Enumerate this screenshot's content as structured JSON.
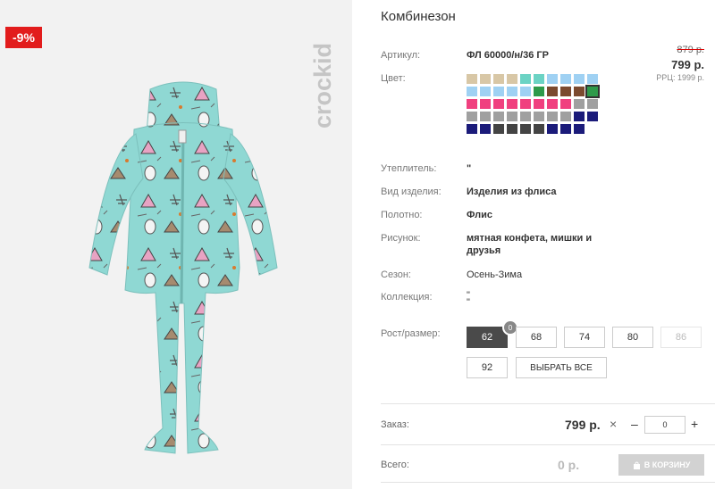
{
  "badge": {
    "discount": "-9%"
  },
  "brand": {
    "logo_text": "crockid"
  },
  "product": {
    "title": "Комбинезон",
    "article_label": "Артикул:",
    "article_value": "ФЛ 60000/н/36 ГР",
    "color_label": "Цвет:",
    "old_price": "879 р.",
    "price": "799 р.",
    "rrp": "РРЦ: 1999 р.",
    "insulation_label": "Утеплитель:",
    "insulation_value": "\"",
    "type_label": "Вид изделия:",
    "type_value": "Изделия из флиса",
    "fabric_label": "Полотно:",
    "fabric_value": "Флис",
    "pattern_label": "Рисунок:",
    "pattern_value_1": "мятная конфета, мишки и",
    "pattern_value_2": "друзья",
    "season_label": "Сезон:",
    "season_value": "Осень-Зима",
    "collection_label": "Коллекция:",
    "collection_value_1": "\"",
    "collection_value_2": "\"",
    "size_label": "Рост/размер:"
  },
  "swatches": [
    "#d8c7a6",
    "#d8c7a6",
    "#d8c7a6",
    "#d8c7a6",
    "#6bd3c4",
    "#6bd3c4",
    "#9fd1f3",
    "#9fd1f3",
    "#9fd1f3",
    "#9fd1f3",
    "#9fd1f3",
    "#9fd1f3",
    "#9fd1f3",
    "#9fd1f3",
    "#9fd1f3",
    "#2e9a4a",
    "#7b4a2f",
    "#7b4a2f",
    "#7b4a2f",
    "#2e9a4a",
    "#f0407f",
    "#f0407f",
    "#f0407f",
    "#f0407f",
    "#f0407f",
    "#f0407f",
    "#f0407f",
    "#f0407f",
    "#a0a0a0",
    "#a0a0a0",
    "#a0a0a0",
    "#a0a0a0",
    "#a0a0a0",
    "#a0a0a0",
    "#a0a0a0",
    "#a0a0a0",
    "#a0a0a0",
    "#a0a0a0",
    "#1b1b7a",
    "#1b1b7a",
    "#1b1b7a",
    "#1b1b7a",
    "#444444",
    "#444444",
    "#444444",
    "#444444",
    "#1b1b7a",
    "#1b1b7a",
    "#1b1b7a"
  ],
  "sizes": {
    "items": [
      "62",
      "68",
      "74",
      "80",
      "86",
      "92"
    ],
    "active": "62",
    "disabled": "86",
    "count_badge": "0",
    "select_all": "ВЫБРАТЬ ВСЕ"
  },
  "order": {
    "label": "Заказ:",
    "price": "799 р.",
    "times": "×",
    "minus": "–",
    "qty": "0",
    "plus": "+",
    "total_label": "Всего:",
    "total_value": "0 р.",
    "cart_button": "В КОРЗИНУ"
  },
  "colors": {
    "discount": "#e21c1c",
    "active_size": "#4a4a4a",
    "cart_disabled": "#d2d2d2"
  },
  "icons": {
    "cart": "shopping-bag-icon"
  }
}
